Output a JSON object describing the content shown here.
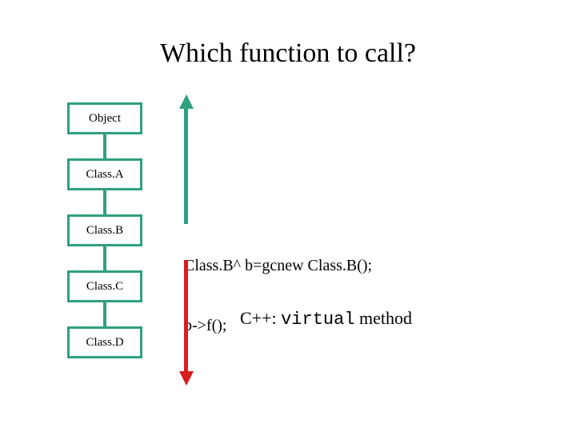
{
  "title": "Which function to call?",
  "classes": {
    "object": "Object",
    "a": "Class.A",
    "b": "Class.B",
    "c": "Class.C",
    "d": "Class.D"
  },
  "code": {
    "line1": "Class.B^ b=gcnew Class.B();",
    "line2": "b->f();"
  },
  "note": {
    "prefix": "C++: ",
    "keyword": "virtual",
    "suffix": " method"
  },
  "colors": {
    "box_border": "#2fa080",
    "arrow_up": "#2fa080",
    "arrow_down": "#d81e1e"
  }
}
